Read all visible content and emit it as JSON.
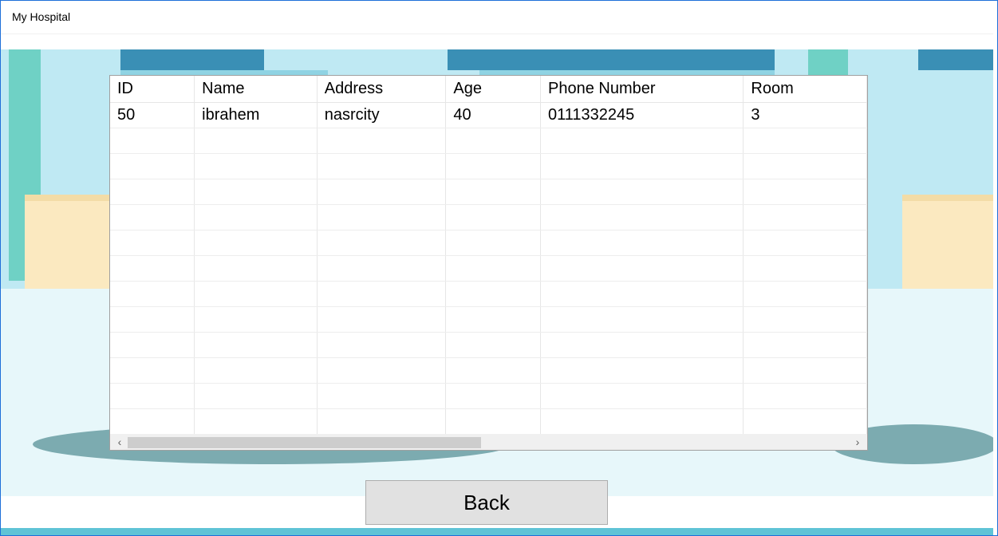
{
  "window": {
    "title": "My Hospital"
  },
  "grid": {
    "columns": [
      "ID",
      "Name",
      "Address",
      "Age",
      "Phone Number",
      "Room"
    ],
    "rows": [
      [
        "50",
        "ibrahem",
        "nasrcity",
        "40",
        "0111332245",
        "3"
      ]
    ],
    "scrollbar": {
      "left_arrow": "‹",
      "right_arrow": "›",
      "position_fraction": 0.0
    }
  },
  "back_button": {
    "label": "Back"
  },
  "colors": {
    "window_border": "#1e6fd9",
    "button_face": "#e1e1e1",
    "background_art": "#bfe9f3"
  }
}
